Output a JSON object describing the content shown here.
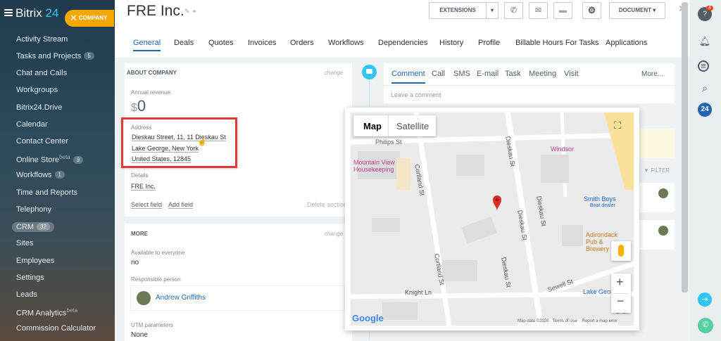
{
  "sidebar": {
    "logo_main": "Bitrix",
    "logo_num": "24",
    "company_label": "COMPANY",
    "items": [
      {
        "label": "Activity Stream"
      },
      {
        "label": "Tasks and Projects",
        "count": "5"
      },
      {
        "label": "Chat and Calls"
      },
      {
        "label": "Workgroups"
      },
      {
        "label": "Bitrix24.Drive"
      },
      {
        "label": "Calendar"
      },
      {
        "label": "Contact Center"
      },
      {
        "label": "Online Store",
        "sup": "beta",
        "count": "9"
      },
      {
        "label": "Workflows",
        "count": "1"
      },
      {
        "label": "Time and Reports"
      },
      {
        "label": "Telephony"
      },
      {
        "label": "CRM",
        "count": "32"
      },
      {
        "label": "Sites"
      },
      {
        "label": "Employees"
      },
      {
        "label": "Settings"
      },
      {
        "label": "Leads"
      },
      {
        "label": "CRM Analytics",
        "sup": "beta"
      },
      {
        "label": "Commission Calculator"
      }
    ]
  },
  "header": {
    "title": "FRE Inc.",
    "extensions_label": "EXTENSIONS",
    "document_label": "DOCUMENT"
  },
  "tabs": [
    "General",
    "Deals",
    "Quotes",
    "Invoices",
    "Orders",
    "Workflows",
    "Dependencies",
    "History",
    "Profile",
    "Billable Hours For Tasks",
    "Applications"
  ],
  "about": {
    "section_title": "ABOUT COMPANY",
    "change": "change",
    "revenue_label": "Annual revenue",
    "revenue_currency": "$",
    "revenue_value": "0",
    "address_label": "Address",
    "address_line1": "Dieskau Street, 11, 11 Dieskau St",
    "address_line2": "Lake George, New York",
    "address_line3": "United States, 12845",
    "details_label": "Details",
    "details_value": "FRE Inc.",
    "select_field": "Select field",
    "add_field": "Add field",
    "delete_section": "Delete section"
  },
  "more": {
    "section_title": "MORE",
    "change": "change",
    "available_label": "Available to everyone",
    "available_value": "no",
    "responsible_label": "Responsible person",
    "responsible_name": "Andrew Griffiths",
    "utm_label": "UTM parameters",
    "utm_value": "None"
  },
  "activity": {
    "tabs": [
      "Comment",
      "Call",
      "SMS",
      "E-mail",
      "Task",
      "Meeting",
      "Visit"
    ],
    "more_label": "More...",
    "placeholder": "Leave a comment",
    "filter_label": "FILTER"
  },
  "map": {
    "tab_map": "Map",
    "tab_satellite": "Satellite",
    "labels": {
      "philips": "Philips St",
      "mountain_view": "Mountain View Housekeeping",
      "windsor": "Windsor",
      "smith_boys": "Smith Boys",
      "boat_dealer": "Boat dealer",
      "adirondack": "Adirondack Pub & Brewery",
      "cortland1": "Cortland St",
      "cortland2": "Cortland St",
      "dieskau1": "Dieskau St",
      "dieskau2": "Dieskau St",
      "dieskau3": "Dieskau St",
      "dieskau4": "Dieskau St",
      "knight": "Knight Ln",
      "sewell": "Sewell St",
      "lake_george": "Lake Georg",
      "saltt": "SALT"
    },
    "google": "Google",
    "footer_data": "Map data ©2020",
    "footer_terms": "Terms of Use",
    "footer_report": "Report a map error"
  },
  "rail": {
    "help_badge": "4",
    "b24": "24"
  },
  "colors": {
    "accent": "#2067b0",
    "company_pill": "#f7a700",
    "highlight_border": "#e03a3a",
    "map_pin": "#d93025"
  }
}
